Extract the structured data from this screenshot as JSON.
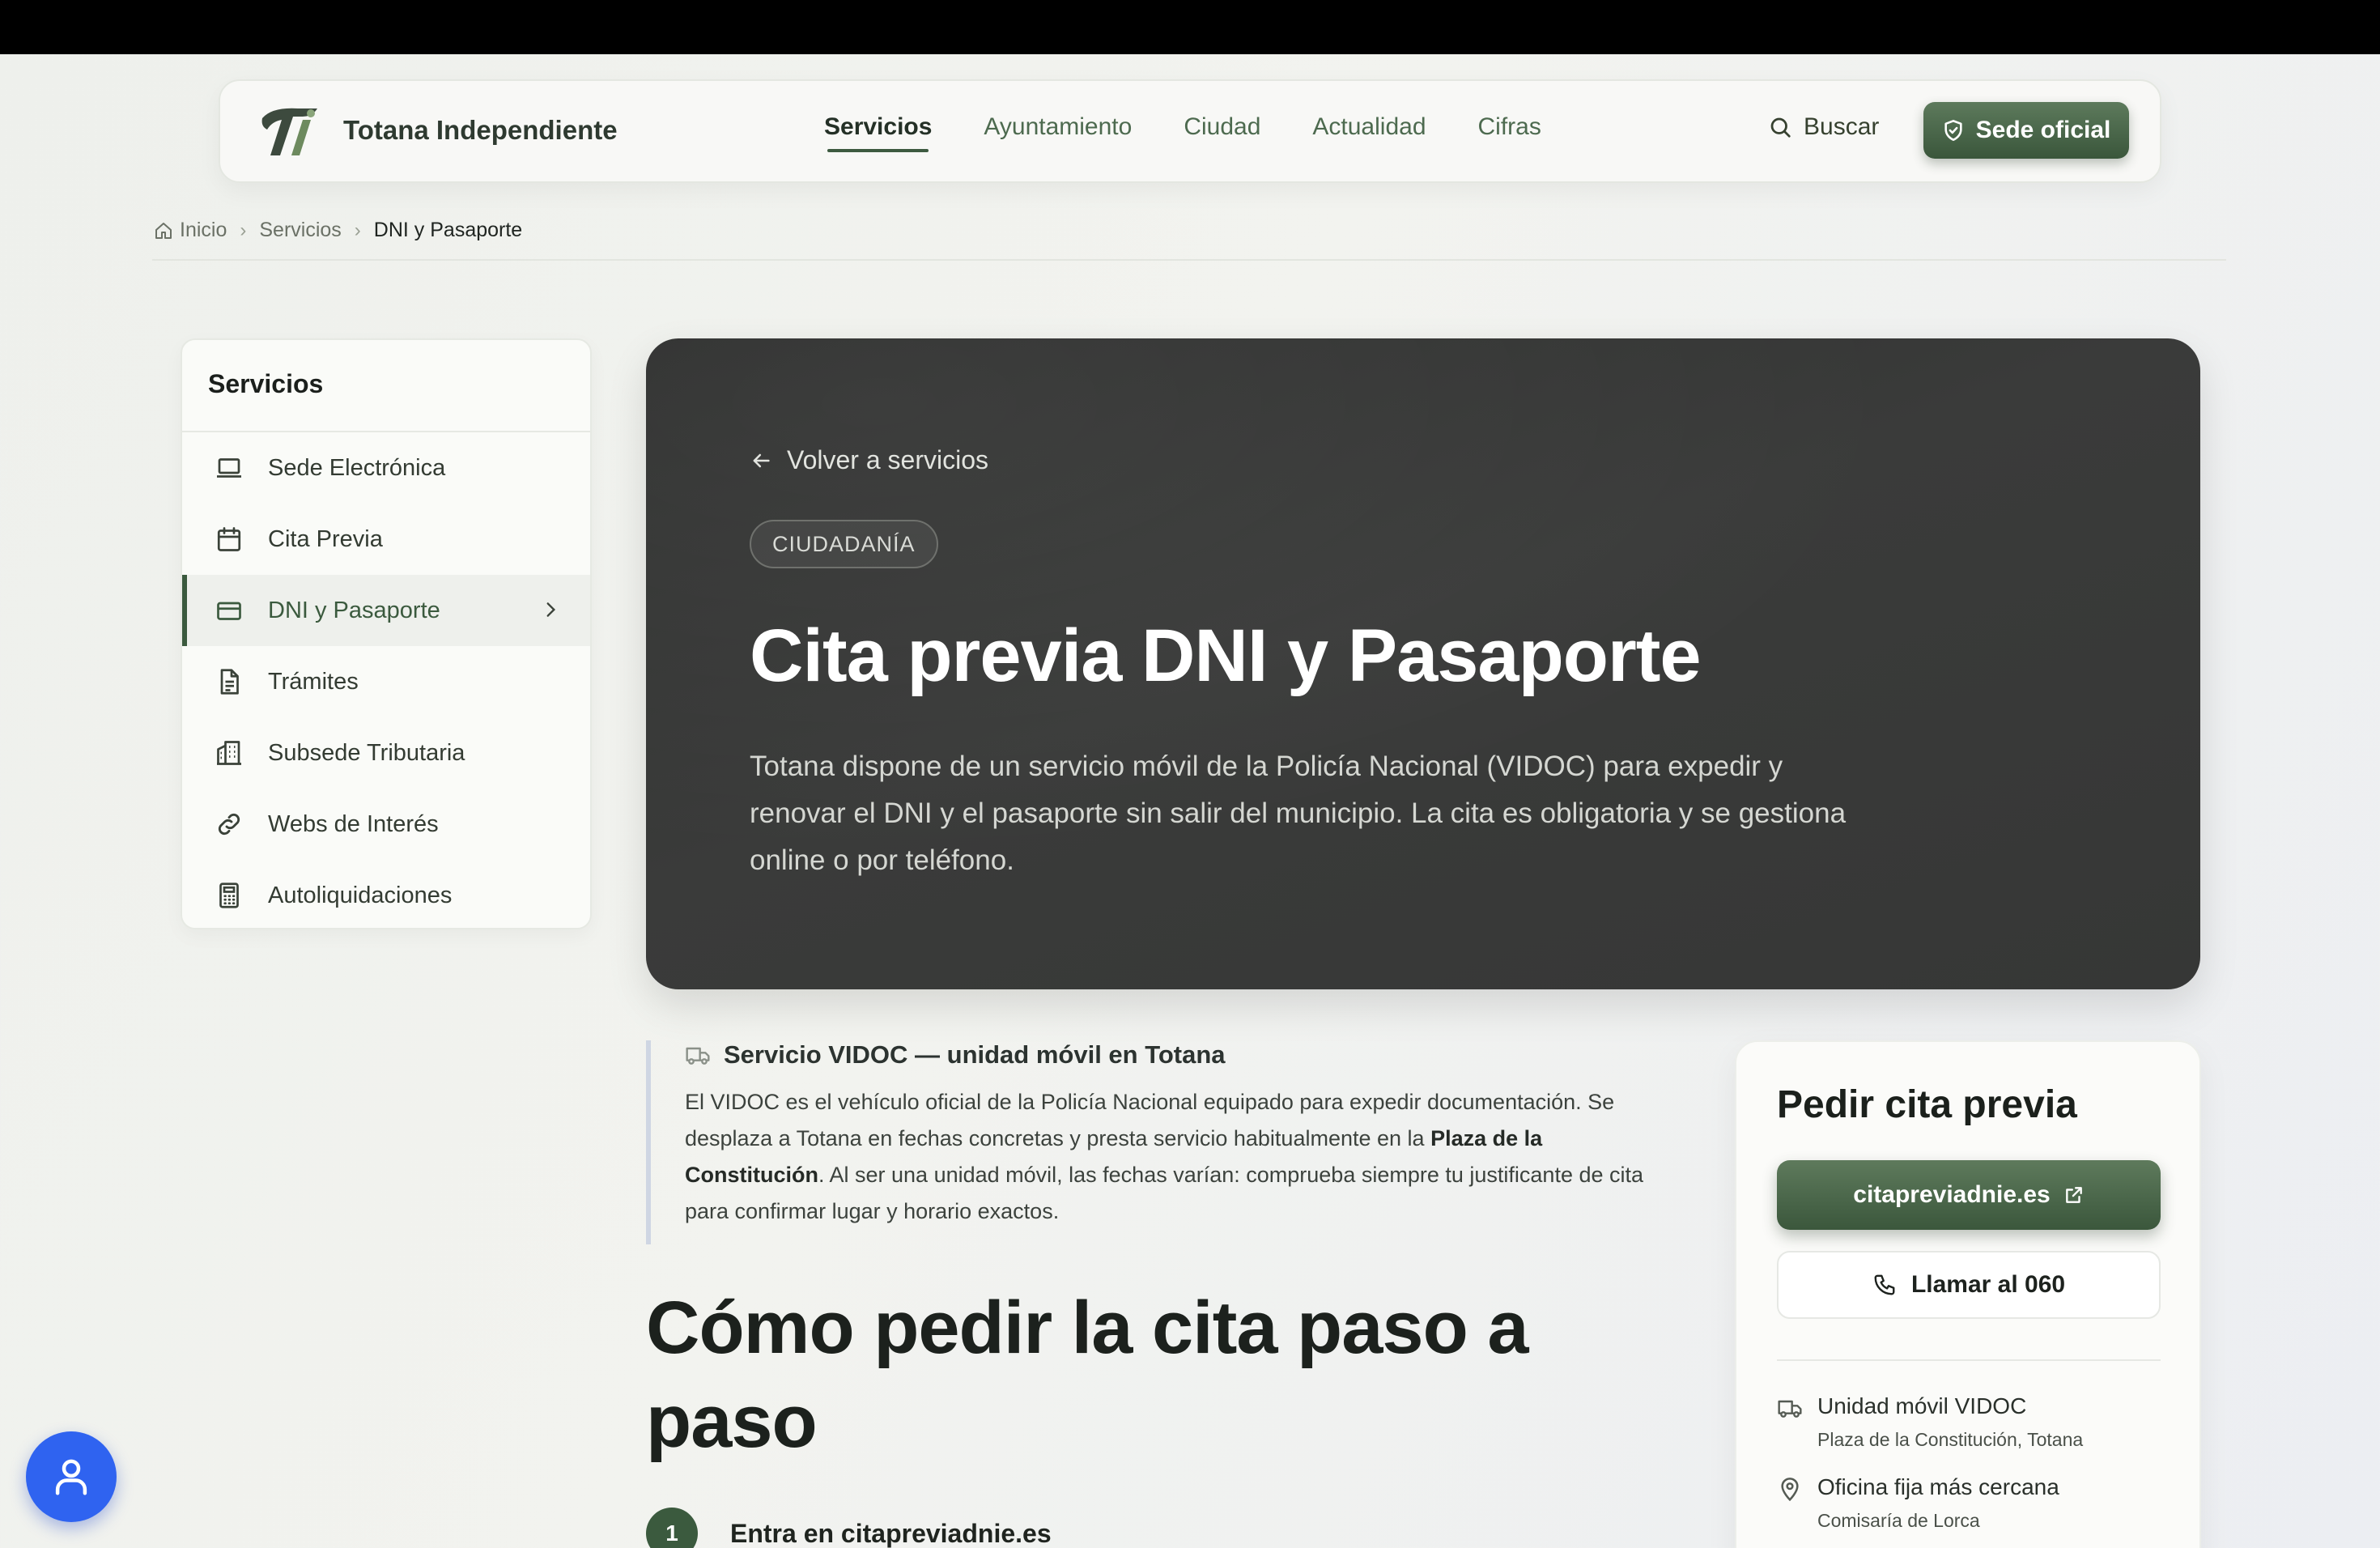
{
  "header": {
    "brand": "Totana Independiente",
    "nav": [
      "Servicios",
      "Ayuntamiento",
      "Ciudad",
      "Actualidad",
      "Cifras"
    ],
    "active_nav": "Servicios",
    "search_label": "Buscar",
    "sede_label": "Sede oficial"
  },
  "breadcrumb": {
    "home": "Inicio",
    "section": "Servicios",
    "current": "DNI y Pasaporte"
  },
  "sidebar": {
    "title": "Servicios",
    "items": [
      {
        "label": "Sede Electrónica",
        "icon": "laptop-icon"
      },
      {
        "label": "Cita Previa",
        "icon": "calendar-icon"
      },
      {
        "label": "DNI y Pasaporte",
        "icon": "id-card-icon",
        "active": true
      },
      {
        "label": "Trámites",
        "icon": "document-icon"
      },
      {
        "label": "Subsede Tributaria",
        "icon": "building-icon"
      },
      {
        "label": "Webs de Interés",
        "icon": "link-icon"
      },
      {
        "label": "Autoliquidaciones",
        "icon": "calculator-icon"
      }
    ]
  },
  "hero": {
    "back_label": "Volver a servicios",
    "tag": "CIUDADANÍA",
    "title": "Cita previa DNI y Pasaporte",
    "description": "Totana dispone de un servicio móvil de la Policía Nacional (VIDOC) para expedir y renovar el DNI y el pasaporte sin salir del municipio. La cita es obligatoria y se gestiona online o por teléfono."
  },
  "note": {
    "title": "Servicio VIDOC — unidad móvil en Totana",
    "body_1": "El VIDOC es el vehículo oficial de la Policía Nacional equipado para expedir documentación. Se desplaza a Totana en fechas concretas y presta servicio habitualmente en la ",
    "body_bold": "Plaza de la Constitución",
    "body_2": ". Al ser una unidad móvil, las fechas varían: comprueba siempre tu justificante de cita para confirmar lugar y horario exactos."
  },
  "steps": {
    "title": "Cómo pedir la cita paso a paso",
    "items": [
      {
        "number": "1",
        "label": "Entra en citapreviadnie.es"
      }
    ]
  },
  "cita_card": {
    "title": "Pedir cita previa",
    "primary_button": "citapreviadnie.es",
    "call_button": "Llamar al 060",
    "locations": [
      {
        "name": "Unidad móvil VIDOC",
        "detail": "Plaza de la Constitución, Totana",
        "icon": "truck-icon"
      },
      {
        "name": "Oficina fija más cercana",
        "detail": "Comisaría de Lorca",
        "icon": "map-pin-icon"
      }
    ]
  },
  "colors": {
    "accent_green": "#3b5a3e",
    "hero_bg": "#333433",
    "accessibility_blue": "#2f63f0"
  }
}
